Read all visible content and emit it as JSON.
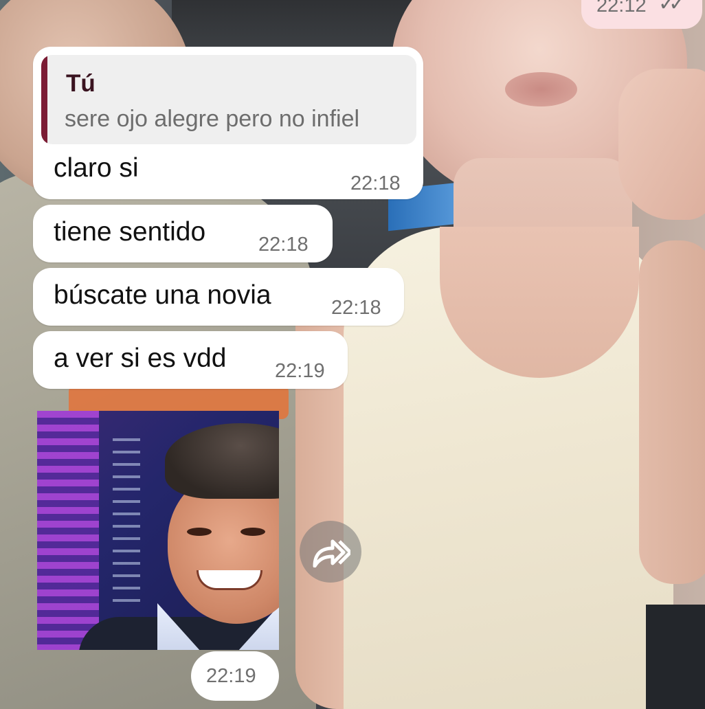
{
  "chat": {
    "sent_top": {
      "time": "22:12",
      "status_icon": "double-check-icon",
      "status_glyph": "✓✓"
    },
    "quoted": {
      "author": "Tú",
      "text": "sere ojo alegre pero no infiel"
    },
    "messages": [
      {
        "text": "claro si",
        "time": "22:18"
      },
      {
        "text": "tiene sentido",
        "time": "22:18"
      },
      {
        "text": "búscate una novia",
        "time": "22:18"
      },
      {
        "text": "a ver si es vdd",
        "time": "22:19"
      }
    ],
    "sticker": {
      "time": "22:19",
      "forward_icon": "forward-icon"
    }
  },
  "colors": {
    "incoming_bubble": "#ffffff",
    "outgoing_bubble": "#fbe0e3",
    "quote_accent": "#7b1c34",
    "time_text": "#6f6f6f"
  }
}
